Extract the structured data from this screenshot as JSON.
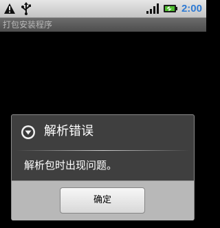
{
  "status_bar": {
    "icons": [
      "warning-icon",
      "usb-icon",
      "signal-icon",
      "battery-icon"
    ],
    "time": "2:00",
    "time_color": "#2f7bd4"
  },
  "title_bar": {
    "title": "打包安装程序"
  },
  "dialog": {
    "icon": "alert-circle-icon",
    "title": "解析错误",
    "message": "解析包时出现问题。",
    "ok_label": "确定"
  }
}
